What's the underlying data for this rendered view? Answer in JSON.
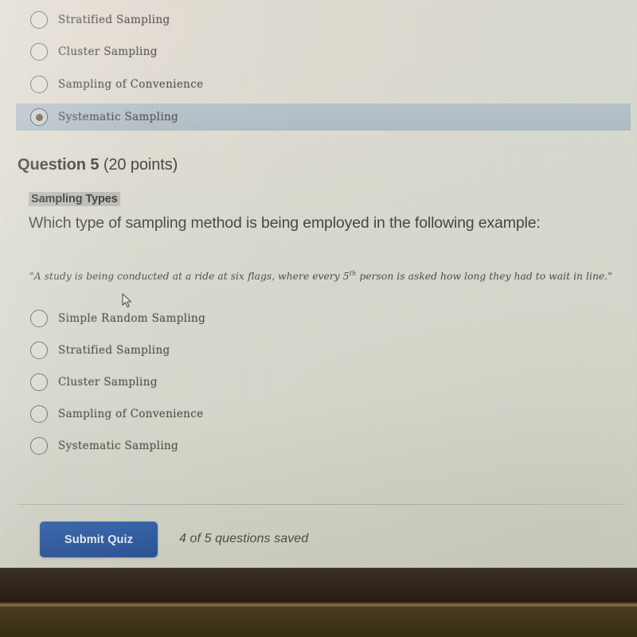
{
  "screen": {
    "previous_question": {
      "options": [
        {
          "label": "Stratified Sampling",
          "selected": false
        },
        {
          "label": "Cluster Sampling",
          "selected": false
        },
        {
          "label": "Sampling of Convenience",
          "selected": false
        },
        {
          "label": "Systematic Sampling",
          "selected": true
        }
      ]
    },
    "question": {
      "number_label": "Question 5",
      "points_label": "(20 points)",
      "topic": "Sampling Types",
      "prompt": "Which type of sampling method is being employed in the following example:",
      "quote_before": "\"A study is being conducted at a ride at six flags, where every 5",
      "quote_superscript": "th",
      "quote_after": " person is asked how long they had to wait in line.\"",
      "options": [
        {
          "label": "Simple Random Sampling",
          "selected": false
        },
        {
          "label": "Stratified Sampling",
          "selected": false
        },
        {
          "label": "Cluster Sampling",
          "selected": false
        },
        {
          "label": "Sampling of Convenience",
          "selected": false
        },
        {
          "label": "Systematic Sampling",
          "selected": false
        }
      ]
    },
    "footer": {
      "submit_label": "Submit Quiz",
      "saved_status": "4 of 5 questions saved"
    },
    "cursor_icon": "mouse-pointer-icon"
  },
  "colors": {
    "page_background": "#d8d9cf",
    "selected_option_highlight": "#b2bfc7",
    "topic_highlight": "#b9b9b2",
    "submit_button": "#2254a2",
    "submit_button_text": "#eef2f8",
    "body_text": "#45433c",
    "bezel": "#2e2318",
    "desk": "#3e3218"
  }
}
